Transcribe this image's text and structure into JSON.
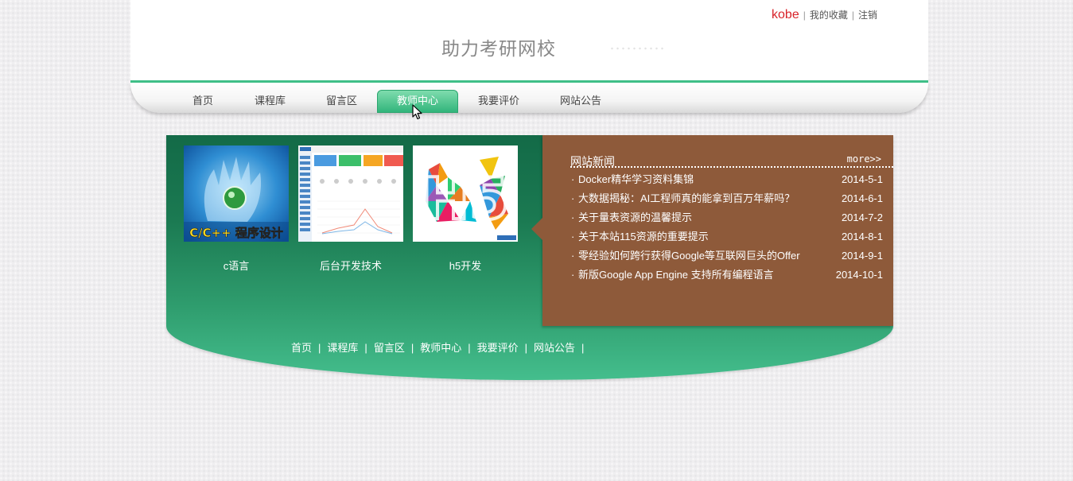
{
  "header": {
    "user": "kobe",
    "favorites_link": "我的收藏",
    "logout_link": "注销",
    "site_title": "助力考研网校"
  },
  "nav": {
    "items": [
      {
        "label": "首页"
      },
      {
        "label": "课程库"
      },
      {
        "label": "留言区"
      },
      {
        "label": "教师中心",
        "active": true
      },
      {
        "label": "我要评价"
      },
      {
        "label": "网站公告"
      }
    ]
  },
  "courses": [
    {
      "label": "c语言",
      "thumb_text": "C/C++ 程序设计"
    },
    {
      "label": "后台开发技术"
    },
    {
      "label": "h5开发",
      "thumb_text": "H5"
    }
  ],
  "news": {
    "title": "网站新闻",
    "more": "more>>",
    "items": [
      {
        "text": "Docker精华学习资料集锦",
        "date": "2014-5-1"
      },
      {
        "text": "大数据揭秘：AI工程师真的能拿到百万年薪吗？",
        "date": "2014-6-1"
      },
      {
        "text": "关于量表资源的温馨提示",
        "date": "2014-7-2"
      },
      {
        "text": "关于本站115资源的重要提示",
        "date": "2014-8-1"
      },
      {
        "text": "零经验如何跨行获得Google等互联网巨头的Offer",
        "date": "2014-9-1"
      },
      {
        "text": "新版Google App Engine 支持所有编程语言",
        "date": "2014-10-1"
      }
    ]
  },
  "footer": {
    "links": [
      "首页",
      "课程库",
      "留言区",
      "教师中心",
      "我要评价",
      "网站公告"
    ]
  },
  "colors": {
    "accent": "#3fbf88",
    "main_dark": "#136a47",
    "news_bg": "#8e5a3a",
    "username": "#d8232a"
  }
}
